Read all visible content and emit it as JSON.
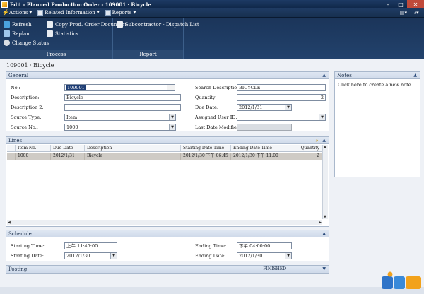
{
  "window": {
    "title": "Edit - Planned Production Order - 109001 · Bicycle"
  },
  "menubar": {
    "actions": "Actions",
    "related": "Related Information",
    "reports": "Reports"
  },
  "ribbon": {
    "process": {
      "caption": "Process",
      "refresh": "Refresh",
      "replan": "Replan",
      "change_status": "Change Status",
      "copy_doc": "Copy Prod. Order Document",
      "statistics": "Statistics"
    },
    "report": {
      "caption": "Report",
      "subcontractor": "Subcontractor - Dispatch List"
    }
  },
  "heading": "109001 · Bicycle",
  "general": {
    "title": "General",
    "no_label": "No.:",
    "no_value": "109001",
    "description_label": "Description:",
    "description_value": "Bicycle",
    "description2_label": "Description 2:",
    "description2_value": "",
    "source_type_label": "Source Type:",
    "source_type_value": "Item",
    "source_no_label": "Source No.:",
    "source_no_value": "1000",
    "search_desc_label": "Search Description:",
    "search_desc_value": "BICYCLE",
    "quantity_label": "Quantity:",
    "quantity_value": "2",
    "due_date_label": "Due Date:",
    "due_date_value": "2012/1/31",
    "assigned_user_label": "Assigned User ID:",
    "assigned_user_value": "",
    "last_modified_label": "Last Date Modified:",
    "last_modified_value": ""
  },
  "lines": {
    "title": "Lines",
    "columns": [
      "Item No.",
      "Due Date",
      "Description",
      "Starting Date-Time",
      "Ending Date-Time",
      "Quantity"
    ],
    "rows": [
      [
        "1000",
        "2012/1/31",
        "Bicycle",
        "2012/1/30 下午 06:45",
        "2012/1/30 下午 11:00",
        "2"
      ]
    ]
  },
  "schedule": {
    "title": "Schedule",
    "starting_time_label": "Starting Time:",
    "starting_time_value": "上午 11:45:00",
    "starting_date_label": "Starting Date:",
    "starting_date_value": "2012/1/30",
    "ending_time_label": "Ending Time:",
    "ending_time_value": "下午 04:00:00",
    "ending_date_label": "Ending Date:",
    "ending_date_value": "2012/1/30"
  },
  "posting": {
    "title": "Posting",
    "status": "FINISHED"
  },
  "notes": {
    "title": "Notes",
    "link": "Click here to create a new note."
  },
  "colors": {
    "titlebar": "#1d3a64",
    "ribbon": "#22426c",
    "selection": "#1f3e75",
    "row_highlight": "#cfcbc5"
  }
}
